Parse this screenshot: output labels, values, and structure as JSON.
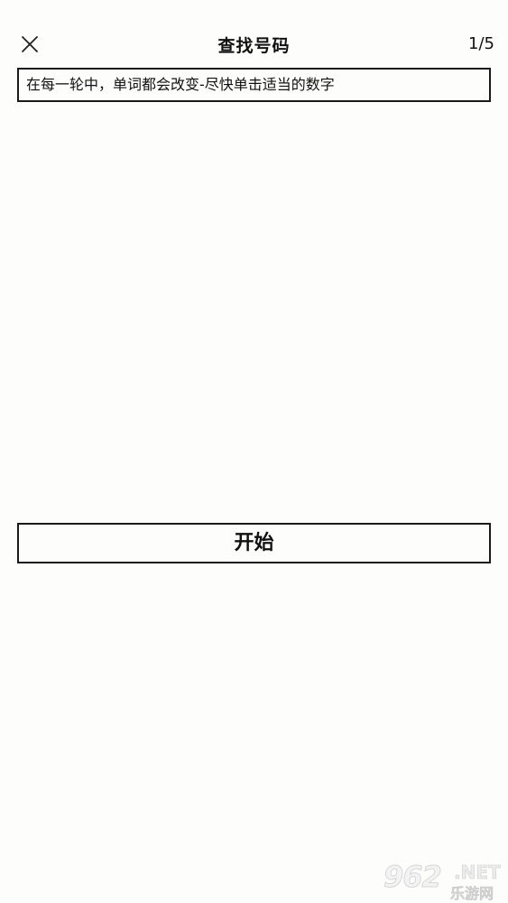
{
  "header": {
    "close_icon": "close-icon",
    "title": "查找号码",
    "page_counter": "1/5"
  },
  "instructions": {
    "text": "在每一轮中，单词都会改变-尽快单击适当的数字"
  },
  "actions": {
    "start_label": "开始"
  },
  "watermark": {
    "digits": "962",
    "domain": ".NET",
    "site_name": "乐游网"
  },
  "colors": {
    "background": "#fdfdfc",
    "border": "#1a1a1a",
    "text": "#111111"
  }
}
